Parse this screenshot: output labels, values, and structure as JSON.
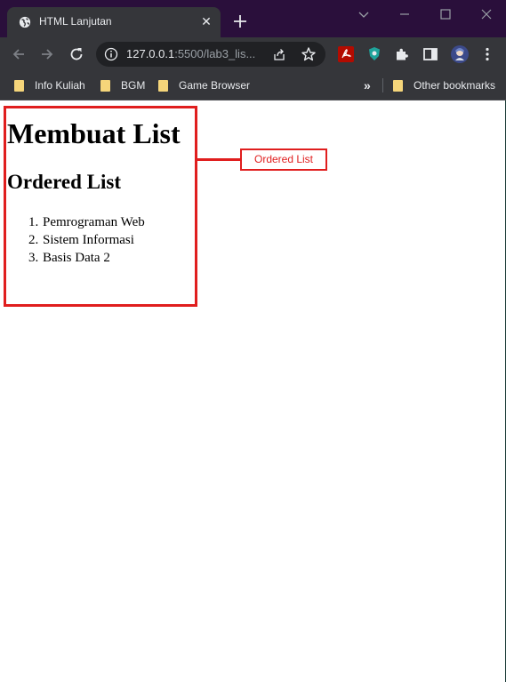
{
  "browser": {
    "tab": {
      "title": "HTML Lanjutan",
      "close_glyph": "✕",
      "favicon": "globe-icon"
    },
    "window_controls": [
      "chevron-down-icon",
      "minimize-icon",
      "maximize-icon",
      "close-icon"
    ],
    "toolbar": {
      "url_host": "127.0.0.1",
      "url_rest": ":5500/lab3_lis...",
      "icons": [
        "back-arrow-icon",
        "forward-arrow-icon",
        "reload-icon",
        "info-icon",
        "share-icon",
        "star-icon",
        "pdf-extension-icon",
        "shield-extension-icon",
        "extensions-puzzle-icon",
        "side-panel-icon",
        "profile-avatar",
        "kebab-menu-icon"
      ]
    },
    "bookmarks": {
      "items": [
        "Info Kuliah",
        "BGM",
        "Game Browser"
      ],
      "overflow_glyph": "»",
      "other": "Other bookmarks"
    }
  },
  "page": {
    "h1": "Membuat List",
    "h2": "Ordered List",
    "list": [
      {
        "num": "1.",
        "text": "Pemrograman Web"
      },
      {
        "num": "2.",
        "text": "Sistem Informasi"
      },
      {
        "num": "3.",
        "text": "Basis Data 2"
      }
    ],
    "annotation": {
      "label": "Ordered List",
      "color": "#e01e1e"
    }
  }
}
